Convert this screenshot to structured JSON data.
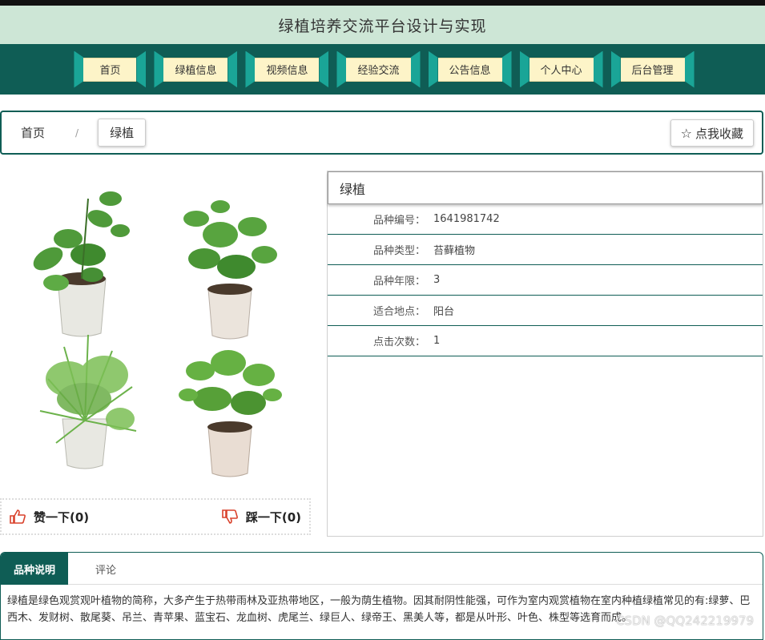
{
  "header": {
    "title": "绿植培养交流平台设计与实现"
  },
  "nav": {
    "items": [
      {
        "label": "首页"
      },
      {
        "label": "绿植信息"
      },
      {
        "label": "视频信息"
      },
      {
        "label": "经验交流"
      },
      {
        "label": "公告信息"
      },
      {
        "label": "个人中心"
      },
      {
        "label": "后台管理"
      }
    ]
  },
  "breadcrumb": {
    "home": "首页",
    "separator": "/",
    "current": "绿植"
  },
  "favorite": {
    "label": "点我收藏"
  },
  "vote": {
    "like": "赞一下(0)",
    "dislike": "踩一下(0)"
  },
  "info": {
    "title": "绿植",
    "rows": [
      {
        "key": "品种编号：",
        "value": "1641981742"
      },
      {
        "key": "品种类型：",
        "value": "苔藓植物"
      },
      {
        "key": "品种年限：",
        "value": "3"
      },
      {
        "key": "适合地点：",
        "value": "阳台"
      },
      {
        "key": "点击次数：",
        "value": "1"
      }
    ]
  },
  "tabs": [
    {
      "label": "品种说明"
    },
    {
      "label": "评论"
    }
  ],
  "description": "绿植是绿色观赏观叶植物的简称，大多产生于热带雨林及亚热带地区，一般为荫生植物。因其耐阴性能强，可作为室内观赏植物在室内种植绿植常见的有:绿萝、巴西木、发财树、散尾葵、吊兰、青苹果、蓝宝石、龙血树、虎尾兰、绿巨人、绿帝王、黑美人等，都是从叶形、叶色、株型等选育而成。",
  "watermark": "CSDN @QQ242219979",
  "colors": {
    "primary": "#0f5d55",
    "accent": "#1aa597",
    "header_bg": "#cde6d6",
    "nav_face": "#fdf4c8"
  }
}
